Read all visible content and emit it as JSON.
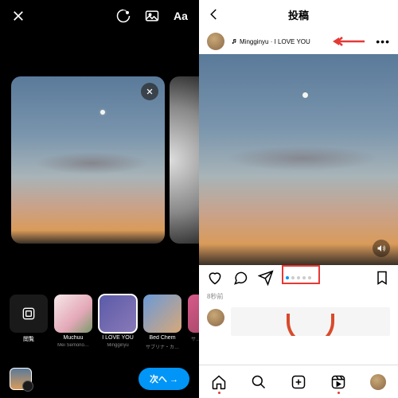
{
  "left": {
    "top_icons": [
      "close",
      "loop",
      "image",
      "text-aa"
    ],
    "music": {
      "browse_label": "閲覧",
      "items": [
        {
          "title": "Muchuu",
          "artist": "Mei Semono…"
        },
        {
          "title": "I LOVE YOU",
          "artist": "Mingginyu"
        },
        {
          "title": "Bed Chem",
          "artist": "サブリナ・カ…"
        },
        {
          "title": "",
          "artist": "サ…"
        }
      ],
      "selected_index": 2
    },
    "next_label": "次へ →"
  },
  "right": {
    "header_title": "投稿",
    "song_line": "Mingginyu · I LOVE YOU",
    "page_dots": {
      "count": 5,
      "active": 0
    },
    "timestamp": "8秒前",
    "tabs": [
      "home",
      "search",
      "create",
      "reels",
      "profile"
    ]
  }
}
